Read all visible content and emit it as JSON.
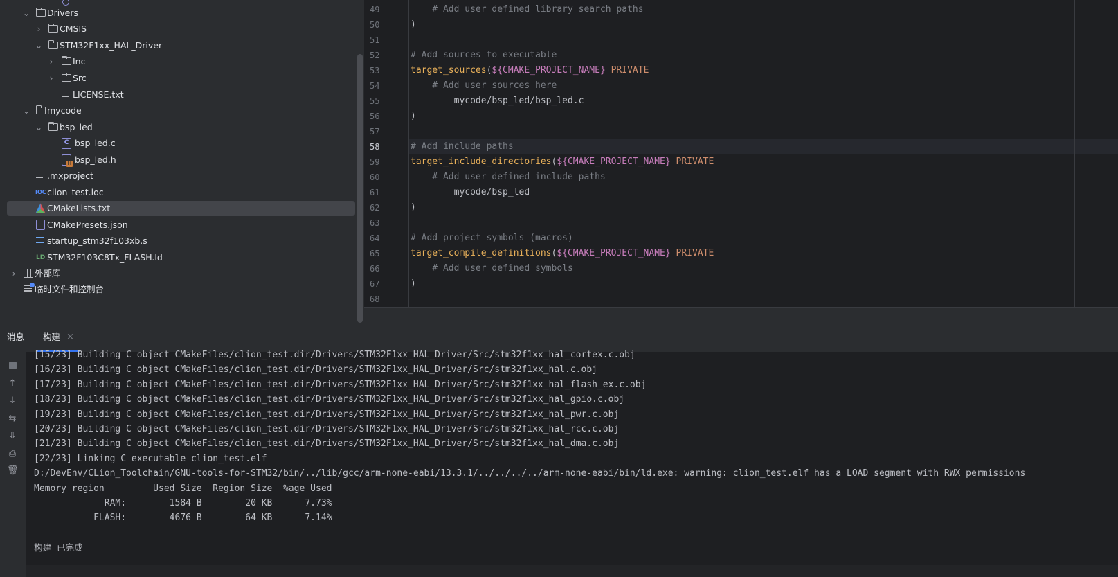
{
  "tree": {
    "items": [
      {
        "label": "Drivers"
      },
      {
        "label": "CMSIS"
      },
      {
        "label": "STM32F1xx_HAL_Driver"
      },
      {
        "label": "Inc"
      },
      {
        "label": "Src"
      },
      {
        "label": "LICENSE.txt"
      },
      {
        "label": "mycode"
      },
      {
        "label": "bsp_led"
      },
      {
        "label": "bsp_led.c"
      },
      {
        "label": "bsp_led.h"
      },
      {
        "label": ".mxproject"
      },
      {
        "label": "clion_test.ioc"
      },
      {
        "label": "CMakeLists.txt"
      },
      {
        "label": "CMakePresets.json"
      },
      {
        "label": "startup_stm32f103xb.s"
      },
      {
        "label": "STM32F103C8Tx_FLASH.ld"
      },
      {
        "label": "外部库"
      },
      {
        "label": "临时文件和控制台"
      }
    ],
    "icons": {
      "ioc": "IOC",
      "ld": "LD",
      "c": "C",
      "h": "H"
    }
  },
  "editor": {
    "current_line": "58",
    "lines": [
      {
        "num": "49",
        "text": "    # Add user defined library search paths"
      },
      {
        "num": "50",
        "text": ")"
      },
      {
        "num": "51",
        "text": ""
      },
      {
        "num": "52",
        "text": "# Add sources to executable"
      },
      {
        "num": "53",
        "fn": "target_sources",
        "open": "(",
        "var": "${CMAKE_PROJECT_NAME}",
        "kw": " PRIVATE"
      },
      {
        "num": "54",
        "text": "    # Add user sources here"
      },
      {
        "num": "55",
        "text": "        mycode/bsp_led/bsp_led.c"
      },
      {
        "num": "56",
        "text": ")"
      },
      {
        "num": "57",
        "text": ""
      },
      {
        "num": "58",
        "text": "# Add include paths"
      },
      {
        "num": "59",
        "fn": "target_include_directories",
        "open": "(",
        "var": "${CMAKE_PROJECT_NAME}",
        "kw": " PRIVATE"
      },
      {
        "num": "60",
        "text": "    # Add user defined include paths"
      },
      {
        "num": "61",
        "text": "        mycode/bsp_led"
      },
      {
        "num": "62",
        "text": ")"
      },
      {
        "num": "63",
        "text": ""
      },
      {
        "num": "64",
        "text": "# Add project symbols (macros)"
      },
      {
        "num": "65",
        "fn": "target_compile_definitions",
        "open": "(",
        "var": "${CMAKE_PROJECT_NAME}",
        "kw": " PRIVATE"
      },
      {
        "num": "66",
        "text": "    # Add user defined symbols"
      },
      {
        "num": "67",
        "text": ")"
      },
      {
        "num": "68",
        "text": ""
      }
    ]
  },
  "bottom": {
    "tabs": {
      "messages": "消息",
      "build": "构建",
      "close": "×"
    },
    "console": [
      "[15/23] Building C object CMakeFiles/clion_test.dir/Drivers/STM32F1xx_HAL_Driver/Src/stm32f1xx_hal_cortex.c.obj",
      "[16/23] Building C object CMakeFiles/clion_test.dir/Drivers/STM32F1xx_HAL_Driver/Src/stm32f1xx_hal.c.obj",
      "[17/23] Building C object CMakeFiles/clion_test.dir/Drivers/STM32F1xx_HAL_Driver/Src/stm32f1xx_hal_flash_ex.c.obj",
      "[18/23] Building C object CMakeFiles/clion_test.dir/Drivers/STM32F1xx_HAL_Driver/Src/stm32f1xx_hal_gpio.c.obj",
      "[19/23] Building C object CMakeFiles/clion_test.dir/Drivers/STM32F1xx_HAL_Driver/Src/stm32f1xx_hal_pwr.c.obj",
      "[20/23] Building C object CMakeFiles/clion_test.dir/Drivers/STM32F1xx_HAL_Driver/Src/stm32f1xx_hal_rcc.c.obj",
      "[21/23] Building C object CMakeFiles/clion_test.dir/Drivers/STM32F1xx_HAL_Driver/Src/stm32f1xx_hal_dma.c.obj",
      "[22/23] Linking C executable clion_test.elf",
      "D:/DevEnv/CLion_Toolchain/GNU-tools-for-STM32/bin/../lib/gcc/arm-none-eabi/13.3.1/../../../../arm-none-eabi/bin/ld.exe: warning: clion_test.elf has a LOAD segment with RWX permissions",
      "Memory region         Used Size  Region Size  %age Used",
      "             RAM:        1584 B        20 KB      7.73%",
      "           FLASH:        4676 B        64 KB      7.14%",
      "",
      "构建  已完成"
    ]
  },
  "colors": {
    "accent": "#3574f0",
    "editor_bg": "#1e1f22",
    "panel_bg": "#2b2d30",
    "comment": "#7a7e85",
    "function": "#e8b05a",
    "keyword": "#cf8e6d",
    "variable": "#c77dbb"
  }
}
